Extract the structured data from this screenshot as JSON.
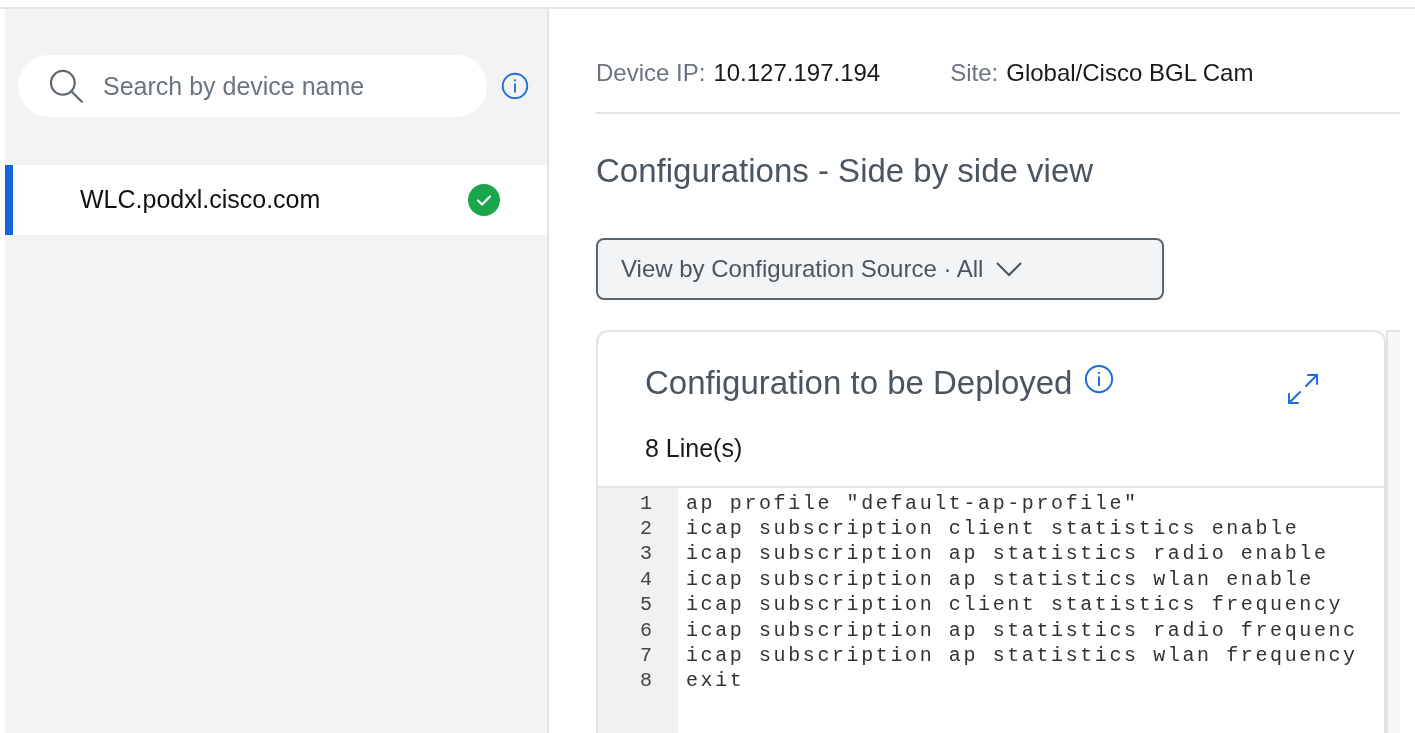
{
  "sidebar": {
    "search": {
      "placeholder": "Search by device name"
    },
    "devices": [
      {
        "name": "WLC.podxl.cisco.com",
        "selected": true,
        "ok": true
      }
    ]
  },
  "device_info": [
    {
      "label": "Device IP:",
      "value": "10.127.197.194"
    },
    {
      "label": "Site:",
      "value": "Global/Cisco BGL Cam"
    }
  ],
  "section_title": "Configurations - Side by side view",
  "view_dropdown": {
    "label": "View by Configuration Source · All"
  },
  "config_panel": {
    "title": "Configuration to be Deployed",
    "line_count": "8 Line(s)",
    "lines": [
      {
        "number": "1",
        "text": "ap profile \"default-ap-profile\""
      },
      {
        "number": "2",
        "text": "icap subscription client statistics enable"
      },
      {
        "number": "3",
        "text": "icap subscription ap statistics radio enable"
      },
      {
        "number": "4",
        "text": "icap subscription ap statistics wlan enable"
      },
      {
        "number": "5",
        "text": "icap subscription client statistics frequency"
      },
      {
        "number": "6",
        "text": "icap subscription ap statistics radio frequenc"
      },
      {
        "number": "7",
        "text": "icap subscription ap statistics wlan frequency"
      },
      {
        "number": "8",
        "text": "exit"
      }
    ]
  }
}
